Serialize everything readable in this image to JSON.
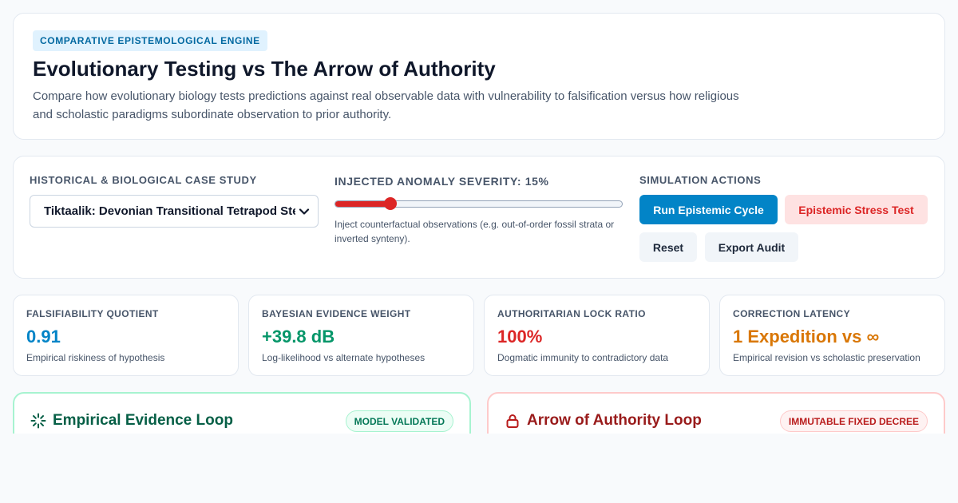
{
  "header": {
    "eyebrow": "COMPARATIVE EPISTEMOLOGICAL ENGINE",
    "title": "Evolutionary Testing vs The Arrow of Authority",
    "description": "Compare how evolutionary biology tests predictions against real observable data with vulnerability to falsification versus how religious and scholastic paradigms subordinate observation to prior authority."
  },
  "controls": {
    "case_study_label": "HISTORICAL & BIOLOGICAL CASE STUDY",
    "case_study_selected": "Tiktaalik: Devonian Transitional Tetrapod Stem",
    "anomaly_label": "INJECTED ANOMALY SEVERITY: ",
    "anomaly_value_text": "15%",
    "anomaly_value": 15,
    "anomaly_hint": "Inject counterfactual observations (e.g. out-of-order fossil strata or inverted synteny).",
    "actions_label": "SIMULATION ACTIONS",
    "buttons": {
      "run": "Run Epistemic Cycle",
      "stress": "Epistemic Stress Test",
      "reset": "Reset",
      "export": "Export Audit"
    }
  },
  "metrics": [
    {
      "label": "FALSIFIABILITY QUOTIENT",
      "value": "0.91",
      "sub": "Empirical riskiness of hypothesis",
      "color": "#0284c7"
    },
    {
      "label": "BAYESIAN EVIDENCE WEIGHT",
      "value": "+39.8 dB",
      "sub": "Log-likelihood vs alternate hypotheses",
      "color": "#059669"
    },
    {
      "label": "AUTHORITARIAN LOCK RATIO",
      "value": "100%",
      "sub": "Dogmatic immunity to contradictory data",
      "color": "#dc2626"
    },
    {
      "label": "CORRECTION LATENCY",
      "value": "1 Expedition vs ∞",
      "sub": "Empirical revision vs scholastic preservation",
      "color": "#d97706"
    }
  ],
  "loops": {
    "empirical": {
      "title": "Empirical Evidence Loop",
      "badge": "MODEL VALIDATED",
      "icon": "loader-icon",
      "color": "#065f46"
    },
    "authority": {
      "title": "Arrow of Authority Loop",
      "badge": "IMMUTABLE FIXED DECREE",
      "icon": "lock-icon",
      "color": "#991b1b"
    }
  }
}
